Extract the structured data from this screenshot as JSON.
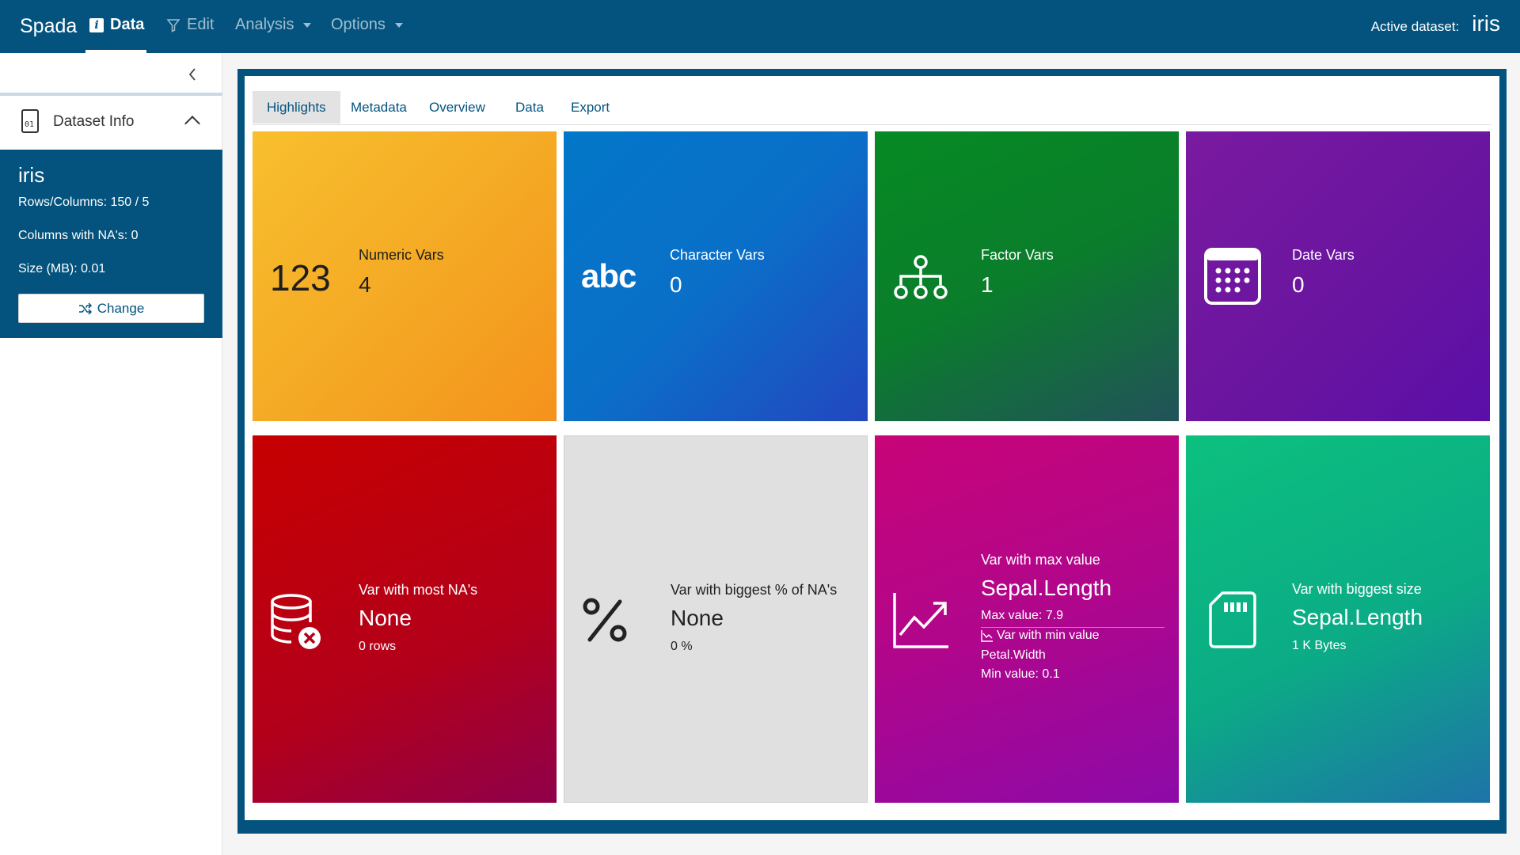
{
  "navbar": {
    "brand": "Spada",
    "items": [
      {
        "label": "Data",
        "icon": "info-icon"
      },
      {
        "label": "Edit",
        "icon": "filter-icon"
      },
      {
        "label": "Analysis"
      },
      {
        "label": "Options"
      }
    ],
    "active_dataset_label": "Active dataset:",
    "active_dataset_value": "iris"
  },
  "sidebar": {
    "header_title": "Dataset Info",
    "dataset": {
      "name": "iris",
      "rows_columns": "Rows/Columns: 150 / 5",
      "columns_na": "Columns with NA's: 0",
      "size": "Size (MB): 0.01"
    },
    "change_label": "Change"
  },
  "tabs": [
    {
      "label": "Highlights",
      "active": true
    },
    {
      "label": "Metadata"
    },
    {
      "label": "Overview"
    },
    {
      "label": "Data"
    },
    {
      "label": "Export"
    }
  ],
  "cards": {
    "numeric": {
      "icon_text": "123",
      "label": "Numeric Vars",
      "value": "4"
    },
    "character": {
      "icon_text": "abc",
      "label": "Character Vars",
      "value": "0"
    },
    "factor": {
      "icon": "sitemap-icon",
      "label": "Factor Vars",
      "value": "1"
    },
    "date": {
      "icon": "calendar-icon",
      "label": "Date Vars",
      "value": "0"
    },
    "most_na": {
      "icon": "database-remove-icon",
      "label": "Var with most NA's",
      "value": "None",
      "sub": "0 rows"
    },
    "biggest_na_pct": {
      "icon": "percent-icon",
      "label": "Var with biggest % of NA's",
      "value": "None",
      "sub": "0 %"
    },
    "max_value": {
      "icon": "chart-line-icon",
      "label": "Var with max value",
      "value": "Sepal.Length",
      "max_text": "Max value: 7.9",
      "min_label": "Var with min value",
      "min_var": "Petal.Width",
      "min_text": "Min value: 0.1"
    },
    "biggest_size": {
      "icon": "sd-card-icon",
      "label": "Var with biggest size",
      "value": "Sepal.Length",
      "sub": "1 K Bytes"
    }
  },
  "colors": {
    "primary": "#03537e",
    "numeric": "#f7b12a",
    "character": "#0a6fc8",
    "factor": "#0a7d2b",
    "date": "#6814a0",
    "most_na": "#b3001a",
    "biggest_na_pct": "#e0e0e0",
    "max_value": "#b0068c",
    "biggest_size": "#0bab86"
  }
}
